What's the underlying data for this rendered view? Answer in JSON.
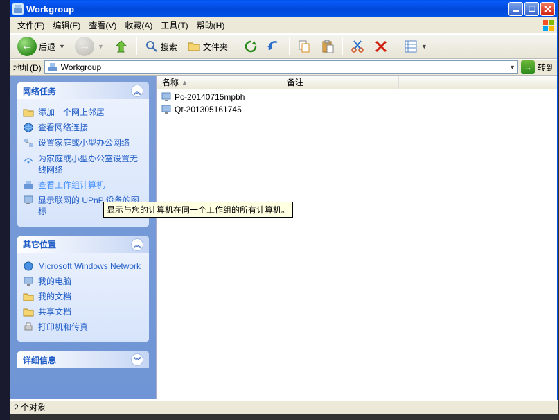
{
  "window": {
    "title": "Workgroup"
  },
  "menu": {
    "file": "文件(F)",
    "edit": "编辑(E)",
    "view": "查看(V)",
    "favorites": "收藏(A)",
    "tools": "工具(T)",
    "help": "帮助(H)"
  },
  "toolbar": {
    "back": "后退",
    "search": "搜索",
    "folders": "文件夹"
  },
  "address": {
    "label": "地址(D)",
    "value": "Workgroup",
    "go": "转到"
  },
  "sidebar": {
    "network_tasks": {
      "title": "网络任务",
      "items": [
        "添加一个网上邻居",
        "查看网络连接",
        "设置家庭或小型办公网络",
        "为家庭或小型办公室设置无线网络",
        "查看工作组计算机",
        "显示联网的 UPnP 设备的图标"
      ]
    },
    "other_places": {
      "title": "其它位置",
      "items": [
        "Microsoft Windows Network",
        "我的电脑",
        "我的文档",
        "共享文档",
        "打印机和传真"
      ]
    },
    "details": {
      "title": "详细信息"
    }
  },
  "columns": {
    "name": "名称",
    "comments": "备注"
  },
  "items": [
    "Pc-20140715mpbh",
    "Qt-201305161745"
  ],
  "tooltip": "显示与您的计算机在同一个工作组的所有计算机。",
  "statusbar": {
    "text": "2 个对象"
  }
}
